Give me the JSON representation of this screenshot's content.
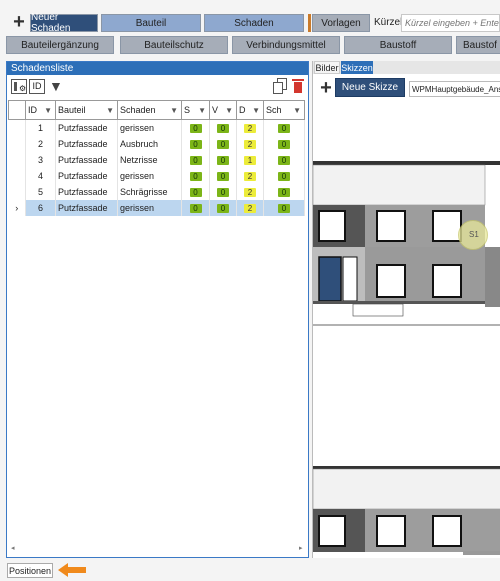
{
  "toolbar": {
    "new_damage": "Neuer Schaden",
    "bauteil": "Bauteil",
    "schaden": "Schaden",
    "vorlagen": "Vorlagen",
    "kuerzel_label": "Kürzel",
    "kuerzel_placeholder": "Kürzel eingeben + Enter..."
  },
  "category_bar": [
    "Bauteilergänzung",
    "Bauteilschutz",
    "Verbindungsmittel",
    "Baustoff",
    "Baustof"
  ],
  "left_panel": {
    "title": "Schadensliste",
    "id_icon": "ID",
    "columns": [
      "ID",
      "Bauteil",
      "Schaden",
      "S",
      "V",
      "D",
      "Sch"
    ],
    "rows": [
      {
        "id": "1",
        "bauteil": "Putzfassade",
        "schaden": "gerissen",
        "s": "0",
        "v": "0",
        "d": "2",
        "sch": "0"
      },
      {
        "id": "2",
        "bauteil": "Putzfassade",
        "schaden": "Ausbruch",
        "s": "0",
        "v": "0",
        "d": "2",
        "sch": "0"
      },
      {
        "id": "3",
        "bauteil": "Putzfassade",
        "schaden": "Netzrisse",
        "s": "0",
        "v": "0",
        "d": "1",
        "sch": "0"
      },
      {
        "id": "4",
        "bauteil": "Putzfassade",
        "schaden": "gerissen",
        "s": "0",
        "v": "0",
        "d": "2",
        "sch": "0"
      },
      {
        "id": "5",
        "bauteil": "Putzfassade",
        "schaden": "Schrägrisse",
        "s": "0",
        "v": "0",
        "d": "2",
        "sch": "0"
      },
      {
        "id": "6",
        "bauteil": "Putzfassade",
        "schaden": "gerissen",
        "s": "0",
        "v": "0",
        "d": "2",
        "sch": "0"
      }
    ],
    "selected_row_id": "6",
    "row_marker": "›"
  },
  "right_panel": {
    "tabs": [
      "Bilder",
      "Skizzen"
    ],
    "active_tab": "Skizzen",
    "new_sketch": "Neue Skizze",
    "sketch_name": "WPMHauptgebäude_Ansic",
    "marker_label": "S1"
  },
  "bottom": {
    "positions_label": "Positionen"
  },
  "colors": {
    "accent": "#2d6fb8",
    "badge_green": "#7cb518",
    "badge_yellow": "#ecec3a",
    "arrow_orange": "#f08a1c",
    "marker_yellow": "#e7e79a"
  },
  "icons": [
    "plus-icon",
    "column-settings-icon",
    "id-icon",
    "filter-icon",
    "copy-icon",
    "trash-icon",
    "arrow-left-icon"
  ]
}
